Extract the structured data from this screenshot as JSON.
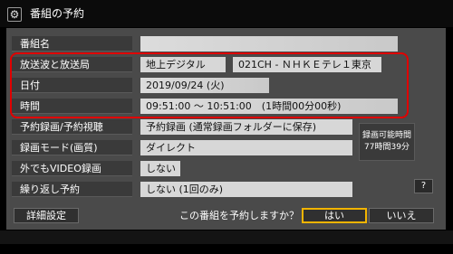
{
  "window": {
    "title": "番組の予約",
    "icon": "gear-icon"
  },
  "fields": {
    "program_name": {
      "label": "番組名",
      "value": ""
    },
    "broadcast": {
      "label": "放送波と放送局",
      "wave": "地上デジタル",
      "station": "021CH - ＮＨＫＥテレ１東京"
    },
    "date": {
      "label": "日付",
      "value": "2019/09/24 (火)"
    },
    "time": {
      "label": "時間",
      "value": "09:51:00 〜 10:51:00　(1時間00分00秒)"
    },
    "record_view": {
      "label": "予約録画/予約視聴",
      "value": "予約録画 (通常録画フォルダーに保存)"
    },
    "record_mode": {
      "label": "録画モード(画質)",
      "value": "ダイレクト"
    },
    "video_out": {
      "label": "外でもVIDEO録画",
      "value": "しない"
    },
    "repeat": {
      "label": "繰り返し予約",
      "value": "しない (1回のみ)"
    }
  },
  "recordable": {
    "line1": "録画可能時間",
    "line2": "77時間39分"
  },
  "help_label": "?",
  "bottom": {
    "detail_button": "詳細設定",
    "question": "この番組を予約しますか？",
    "yes_button": "はい",
    "no_button": "いいえ"
  },
  "colors": {
    "highlight": "#e00000",
    "focus": "#f2b400"
  }
}
